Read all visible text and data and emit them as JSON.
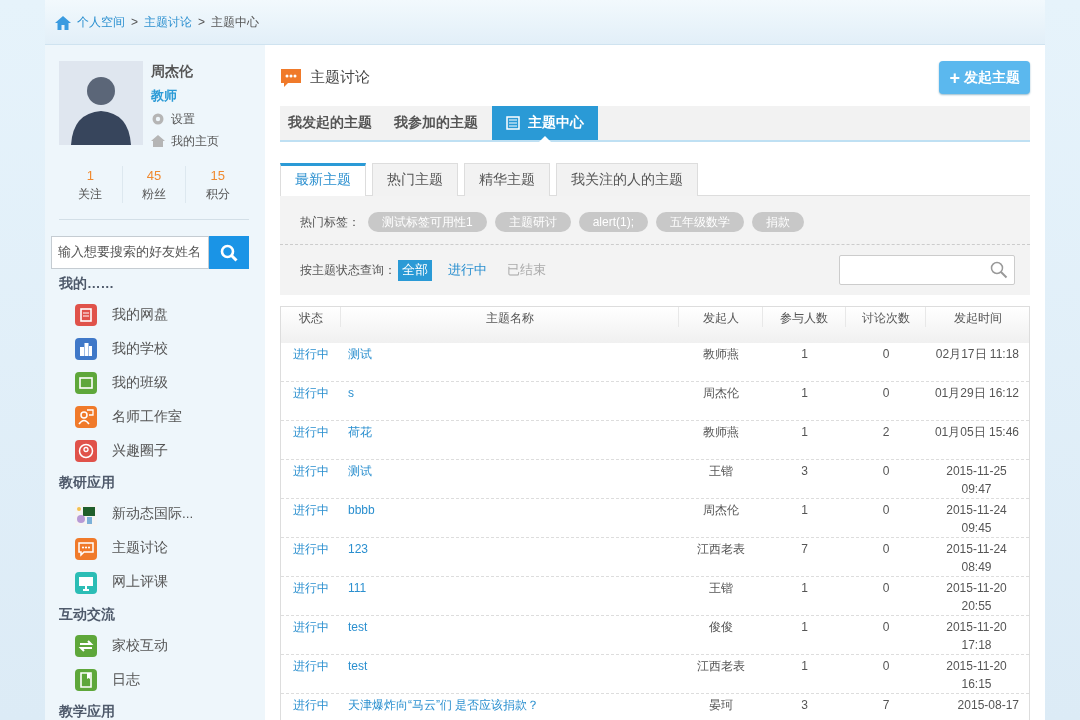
{
  "breadcrumb": [
    {
      "label": "个人空间",
      "link": true
    },
    {
      "label": "主题讨论",
      "link": true
    },
    {
      "label": "主题中心",
      "link": false
    }
  ],
  "breadcrumb_separator": ">",
  "profile": {
    "name": "周杰伦",
    "role": "教师",
    "links": [
      {
        "label": "设置",
        "kind": "settings"
      },
      {
        "label": "我的主页",
        "kind": "home"
      }
    ],
    "stats": [
      {
        "value": "1",
        "label": "关注"
      },
      {
        "value": "45",
        "label": "粉丝"
      },
      {
        "value": "15",
        "label": "积分"
      }
    ]
  },
  "friend_search": {
    "placeholder": "输入想要搜索的好友姓名"
  },
  "sidebar": [
    {
      "title": "我的……",
      "items": [
        {
          "label": "我的网盘",
          "color": "#e0524a",
          "kind": "document"
        },
        {
          "label": "我的学校",
          "color": "#3f78c8",
          "kind": "buildings"
        },
        {
          "label": "我的班级",
          "color": "#5ea73a",
          "kind": "board"
        },
        {
          "label": "名师工作室",
          "color": "#f07a2a",
          "kind": "person"
        },
        {
          "label": "兴趣圈子",
          "color": "#e0524a",
          "kind": "circle"
        }
      ]
    },
    {
      "title": "教研应用",
      "items": [
        {
          "label": "新动态国际...",
          "kind": "picture"
        },
        {
          "label": "主题讨论",
          "color": "#f07a2a",
          "kind": "chat"
        },
        {
          "label": "网上评课",
          "color": "#2bbdb5",
          "kind": "monitor"
        }
      ]
    },
    {
      "title": "互动交流",
      "items": [
        {
          "label": "家校互动",
          "color": "#5ea73a",
          "kind": "exchange"
        },
        {
          "label": "日志",
          "color": "#5ea73a",
          "kind": "book"
        }
      ]
    },
    {
      "title": "教学应用"
    }
  ],
  "page_title": "主题讨论",
  "new_topic_button": {
    "icon": "+",
    "label": "发起主题"
  },
  "sub_tabs": [
    {
      "label": "我发起的主题",
      "selected": false
    },
    {
      "label": "我参加的主题",
      "selected": false
    },
    {
      "label": "主题中心",
      "selected": true
    }
  ],
  "tabs": [
    {
      "label": "最新主题",
      "selected": true
    },
    {
      "label": "热门主题",
      "selected": false
    },
    {
      "label": "精华主题",
      "selected": false
    },
    {
      "label": "我关注的人的主题",
      "selected": false
    }
  ],
  "hot_tags": {
    "label": "热门标签：",
    "tags": [
      "测试标签可用性1",
      "主题研讨",
      "alert(1);",
      "五年级数学",
      "捐款"
    ]
  },
  "status_filter": {
    "label": "按主题状态查询：",
    "options": [
      {
        "label": "全部",
        "selected": true,
        "disabled": false
      },
      {
        "label": "进行中",
        "selected": false,
        "disabled": false
      },
      {
        "label": "已结束",
        "selected": false,
        "disabled": true
      }
    ]
  },
  "table": {
    "columns": [
      "状态",
      "主题名称",
      "发起人",
      "参与人数",
      "讨论次数",
      "发起时间"
    ],
    "rows": [
      {
        "status": "进行中",
        "title": "测试",
        "initiator": "教师燕",
        "participants": "1",
        "discussions": "0",
        "time": "02月17日 11:18"
      },
      {
        "status": "进行中",
        "title": "s",
        "initiator": "周杰伦",
        "participants": "1",
        "discussions": "0",
        "time": "01月29日 16:12"
      },
      {
        "status": "进行中",
        "title": "荷花",
        "initiator": "教师燕",
        "participants": "1",
        "discussions": "2",
        "time": "01月05日 15:46"
      },
      {
        "status": "进行中",
        "title": "测试",
        "initiator": "王锴",
        "participants": "3",
        "discussions": "0",
        "time": "2015-11-25 09:47"
      },
      {
        "status": "进行中",
        "title": "bbbb",
        "initiator": "周杰伦",
        "participants": "1",
        "discussions": "0",
        "time": "2015-11-24 09:45"
      },
      {
        "status": "进行中",
        "title": "123",
        "initiator": "江西老表",
        "participants": "7",
        "discussions": "0",
        "time": "2015-11-24 08:49"
      },
      {
        "status": "进行中",
        "title": "111",
        "initiator": "王锴",
        "participants": "1",
        "discussions": "0",
        "time": "2015-11-20 20:55"
      },
      {
        "status": "进行中",
        "title": "test",
        "initiator": "俊俊",
        "participants": "1",
        "discussions": "0",
        "time": "2015-11-20 17:18"
      },
      {
        "status": "进行中",
        "title": "test",
        "initiator": "江西老表",
        "participants": "1",
        "discussions": "0",
        "time": "2015-11-20 16:15"
      },
      {
        "status": "进行中",
        "title": "天津爆炸向“马云”们 是否应该捐款？",
        "initiator": "晏珂",
        "participants": "3",
        "discussions": "7",
        "time": "2015-08-17"
      }
    ]
  }
}
